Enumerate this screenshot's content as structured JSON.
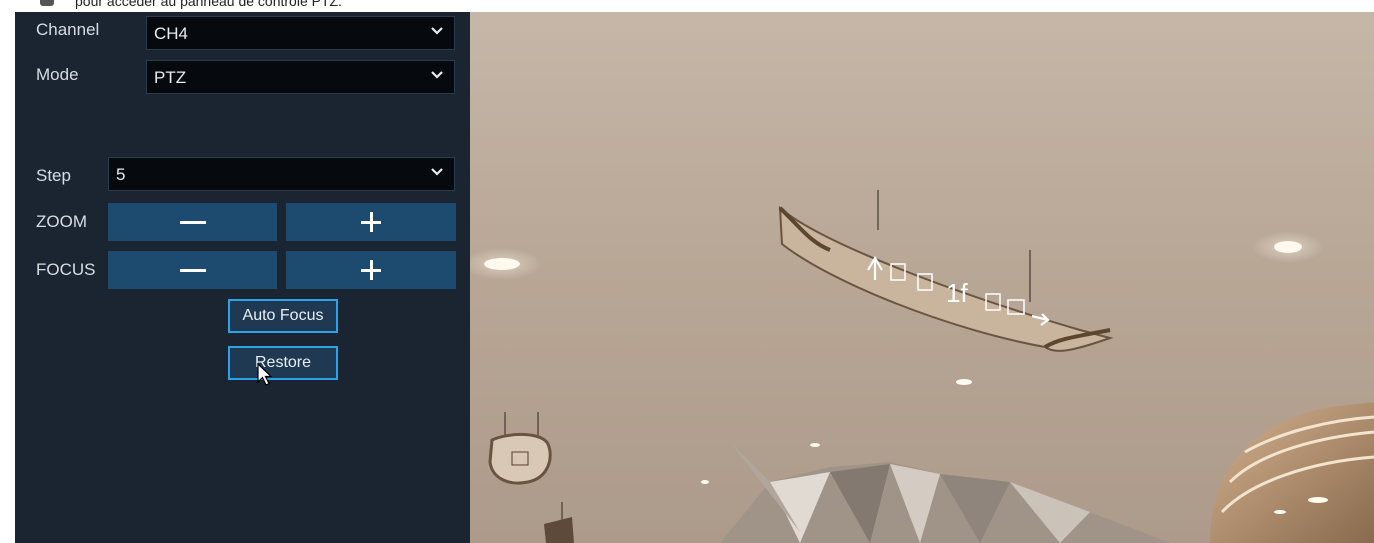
{
  "top_note": "pour accéder au panneau de contrôle PTZ.",
  "panel": {
    "channel": {
      "label": "Channel",
      "value": "CH4"
    },
    "mode": {
      "label": "Mode",
      "value": "PTZ"
    },
    "step": {
      "label": "Step",
      "value": "5"
    },
    "zoom": {
      "label": "ZOOM"
    },
    "focus": {
      "label": "FOCUS"
    },
    "auto_focus_label": "Auto Focus",
    "restore_label": "Restore"
  },
  "video": {
    "sign_text": "1f"
  },
  "colors": {
    "panel_bg": "#1b2532",
    "control_button": "#1d4a6f",
    "accent_border": "#2aa4e6"
  }
}
